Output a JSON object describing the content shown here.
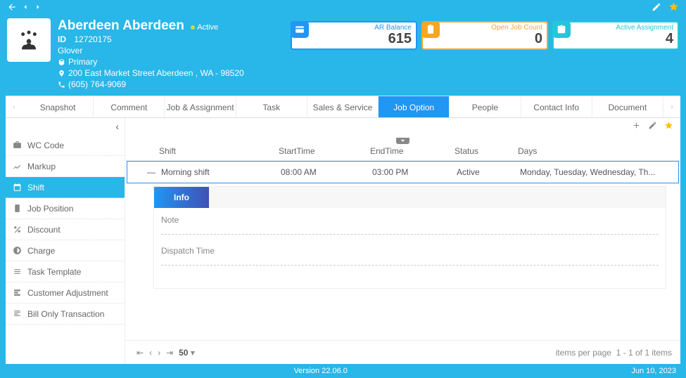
{
  "company": {
    "name": "Aberdeen Aberdeen",
    "status": "Active",
    "id_label": "ID",
    "id": "12720175",
    "industry": "Glover",
    "type": "Primary",
    "address": "200 East Market Street Aberdeen , WA - 98520",
    "phone": "(605) 764-9069"
  },
  "kpis": {
    "ar_balance": {
      "label": "AR Balance",
      "value": "615"
    },
    "open_jobs": {
      "label": "Open Job Count",
      "value": "0"
    },
    "active_assign": {
      "label": "Active Assignment",
      "value": "4"
    }
  },
  "tabs": [
    "Snapshot",
    "Comment",
    "Job & Assignment",
    "Task",
    "Sales & Service",
    "Job Option",
    "People",
    "Contact Info",
    "Document"
  ],
  "active_tab": 5,
  "sidenav": [
    {
      "label": "WC Code",
      "icon": "briefcase"
    },
    {
      "label": "Markup",
      "icon": "chart"
    },
    {
      "label": "Shift",
      "icon": "calendar",
      "active": true
    },
    {
      "label": "Job Position",
      "icon": "clipboard"
    },
    {
      "label": "Discount",
      "icon": "percent"
    },
    {
      "label": "Charge",
      "icon": "coin"
    },
    {
      "label": "Task Template",
      "icon": "list"
    },
    {
      "label": "Customer Adjustment",
      "icon": "cadj"
    },
    {
      "label": "Bill Only Transaction",
      "icon": "bill"
    }
  ],
  "grid": {
    "headers": {
      "shift": "Shift",
      "start": "StartTime",
      "end": "EndTime",
      "status": "Status",
      "days": "Days"
    },
    "rows": [
      {
        "shift": "Morning shift",
        "start": "08:00 AM",
        "end": "03:00 PM",
        "status": "Active",
        "days": "Monday, Tuesday, Wednesday, Th..."
      }
    ],
    "detail": {
      "tab": "Info",
      "note_label": "Note",
      "dispatch_label": "Dispatch Time"
    }
  },
  "pager": {
    "size": "50",
    "info_label": "items per page",
    "range": "1 - 1 of 1 items"
  },
  "footer": {
    "version": "Version 22.06.0",
    "date": "Jun 10, 2023"
  }
}
